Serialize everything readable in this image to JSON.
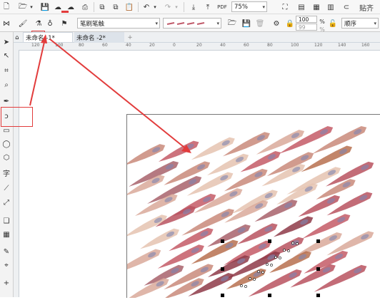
{
  "toolbar_top": {
    "zoom": "75%",
    "snap_label": "贴齐"
  },
  "property_bar": {
    "brush_type": "笔刷笔触",
    "size_values": [
      "100",
      "99"
    ],
    "percent_sign": "%",
    "order_label": "顺序"
  },
  "tabs": [
    {
      "label": "未命名 -1*"
    },
    {
      "label": "未命名 -2*"
    }
  ],
  "ruler": {
    "h_ticks": [
      "120",
      "100",
      "80",
      "60",
      "40",
      "20",
      "0",
      "20",
      "40",
      "60",
      "80",
      "100",
      "120",
      "140",
      "160"
    ]
  },
  "tools": [
    {
      "icon": "pick-tool-icon",
      "glyph": "➤"
    },
    {
      "icon": "shape-tool-icon",
      "glyph": "↖"
    },
    {
      "icon": "crop-tool-icon",
      "glyph": "⌗"
    },
    {
      "icon": "zoom-tool-icon",
      "glyph": "⌕"
    },
    {
      "icon": "pen-tool-icon",
      "glyph": "✒"
    },
    {
      "icon": "artistic-media-tool-icon",
      "glyph": "ↄ"
    },
    {
      "icon": "rectangle-tool-icon",
      "glyph": "▭"
    },
    {
      "icon": "ellipse-tool-icon",
      "glyph": "◯"
    },
    {
      "icon": "polygon-tool-icon",
      "glyph": "⬡"
    },
    {
      "icon": "text-tool-icon",
      "glyph": "字"
    },
    {
      "icon": "dimension-tool-icon",
      "glyph": "⟋"
    },
    {
      "icon": "connector-tool-icon",
      "glyph": "⤢"
    },
    {
      "icon": "shadow-tool-icon",
      "glyph": "❑"
    },
    {
      "icon": "transparency-tool-icon",
      "glyph": "▦"
    },
    {
      "icon": "eyedropper-tool-icon",
      "glyph": "✎"
    },
    {
      "icon": "interactive-fill-tool-icon",
      "glyph": "⌖"
    },
    {
      "icon": "add-tool-icon",
      "glyph": "+"
    }
  ],
  "colors": {
    "annotation_red": "#e23c3c",
    "stroke_palette": [
      "#b9525f",
      "#c98a7a",
      "#a8626b",
      "#d9a99a",
      "#8e3a48",
      "#b7704f",
      "#e5c3b0",
      "#c45a66"
    ]
  }
}
